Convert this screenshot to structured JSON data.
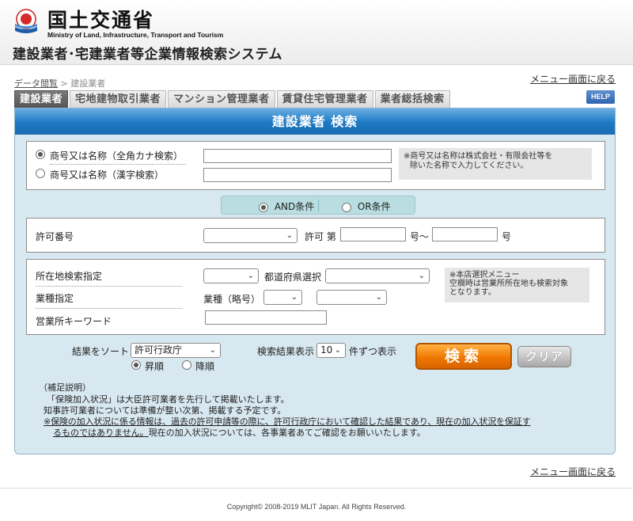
{
  "header": {
    "ministry_ja": "国土交通省",
    "ministry_en": "Ministry of Land, Infrastructure, Transport and Tourism",
    "system_title": "建設業者･宅建業者等企業情報検索システム"
  },
  "breadcrumb": {
    "parent": "データ閲覧",
    "separator": ">",
    "current": "建設業者"
  },
  "menu_return": "メニュー画面に戻る",
  "tabs": [
    {
      "label": "建設業者",
      "active": true
    },
    {
      "label": "宅地建物取引業者",
      "active": false
    },
    {
      "label": "マンション管理業者",
      "active": false
    },
    {
      "label": "賃貸住宅管理業者",
      "active": false
    },
    {
      "label": "業者総括検索",
      "active": false
    }
  ],
  "help_label": "HELP",
  "panel_title": "建設業者 検索",
  "name_search": {
    "kana_label": "商号又は名称（全角カナ検索）",
    "kanji_label": "商号又は名称（漢字検索）",
    "kana_value": "",
    "kanji_value": "",
    "note_line1": "※商号又は名称は株式会社・有限会社等を",
    "note_line2": "除いた名称で入力してください。"
  },
  "condition": {
    "and_label": "AND条件",
    "or_label": "OR条件",
    "selected": "AND"
  },
  "permit": {
    "label": "許可番号",
    "select_value": "",
    "prefix": "許可 第",
    "from_value": "",
    "mid": "号～",
    "to_value": "",
    "suffix": "号"
  },
  "location": {
    "label": "所在地検索指定",
    "select_value": "",
    "pref_label": "都道府県選択",
    "pref_value": "",
    "note_line1": "※本店選択メニュー",
    "note_line2": "空欄時は営業所所在地も検索対象",
    "note_line3": "となります。"
  },
  "industry": {
    "label": "業種指定",
    "abbr_label": "業種（略号）",
    "select1_value": "",
    "select2_value": ""
  },
  "keyword": {
    "label": "営業所キーワード",
    "value": ""
  },
  "sort": {
    "label": "結果をソート",
    "value": "許可行政庁",
    "asc_label": "昇順",
    "desc_label": "降順",
    "selected": "asc"
  },
  "results": {
    "prefix": "検索結果表示",
    "value": "10",
    "suffix": "件ずつ表示"
  },
  "buttons": {
    "search": "検索",
    "clear": "クリア"
  },
  "supplement": {
    "title": "（補足説明）",
    "line1": "「保険加入状況」は大臣許可業者を先行して掲載いたします。",
    "line2": "知事許可業者については準備が整い次第、掲載する予定です。",
    "line3": "※保険の加入状況に係る情報は、過去の許可申請等の際に、許可行政庁において確認した結果であり、現在の加入状況を保証す",
    "line4_underlined": "るものではありません。",
    "line4_rest": "現在の加入状況については、各事業者あてご確認をお願いいたします。"
  },
  "copyright": "Copyright© 2008-2019 MLIT Japan. All Rights Reserved.",
  "colors": {
    "title_bar": "#1c78c4",
    "panel_bg": "#d8e8f0",
    "search_button": "#f07800",
    "active_tab": "#555555"
  }
}
